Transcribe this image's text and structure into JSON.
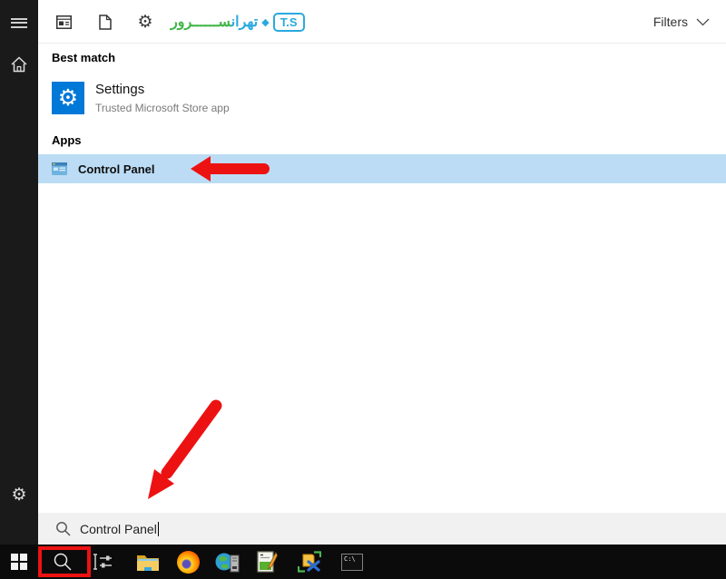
{
  "topbar": {
    "filter_icons": [
      {
        "name": "apps-filter"
      },
      {
        "name": "documents-filter"
      },
      {
        "name": "settings-filter"
      }
    ],
    "logo": {
      "ts_label": "T.S",
      "persian_blue": "تهران",
      "persian_green": "ســــــرور"
    },
    "filters_label": "Filters"
  },
  "sidebar": {
    "items": [
      {
        "name": "menu"
      },
      {
        "name": "home"
      },
      {
        "name": "settings"
      }
    ]
  },
  "results": {
    "best_match_heading": "Best match",
    "best_match": {
      "title": "Settings",
      "subtitle": "Trusted Microsoft Store app"
    },
    "apps_heading": "Apps",
    "apps": [
      {
        "title": "Control Panel"
      }
    ]
  },
  "search_box": {
    "value": "Control Panel"
  },
  "taskbar": {
    "icons": [
      {
        "name": "start"
      },
      {
        "name": "search",
        "highlighted": true
      },
      {
        "name": "task-view"
      },
      {
        "name": "file-explorer"
      },
      {
        "name": "firefox"
      },
      {
        "name": "network-server-app"
      },
      {
        "name": "log-editor-app"
      },
      {
        "name": "repair-tool-app"
      },
      {
        "name": "command-prompt",
        "label": "C:\\"
      }
    ]
  },
  "annotations": {
    "accent_color": "#ed1212",
    "arrow_1_target": "Control Panel result",
    "arrow_2_target": "search input",
    "box_target": "taskbar search button"
  },
  "colors": {
    "highlight_row": "#bbdcf4",
    "settings_tile": "#0078d7",
    "sidebar_bg": "#1a1a1a",
    "taskbar_bg": "#0b0b0b",
    "searchbar_bg": "#f1f1f2",
    "logo_blue": "#2aa9e0",
    "logo_green": "#43b649"
  }
}
